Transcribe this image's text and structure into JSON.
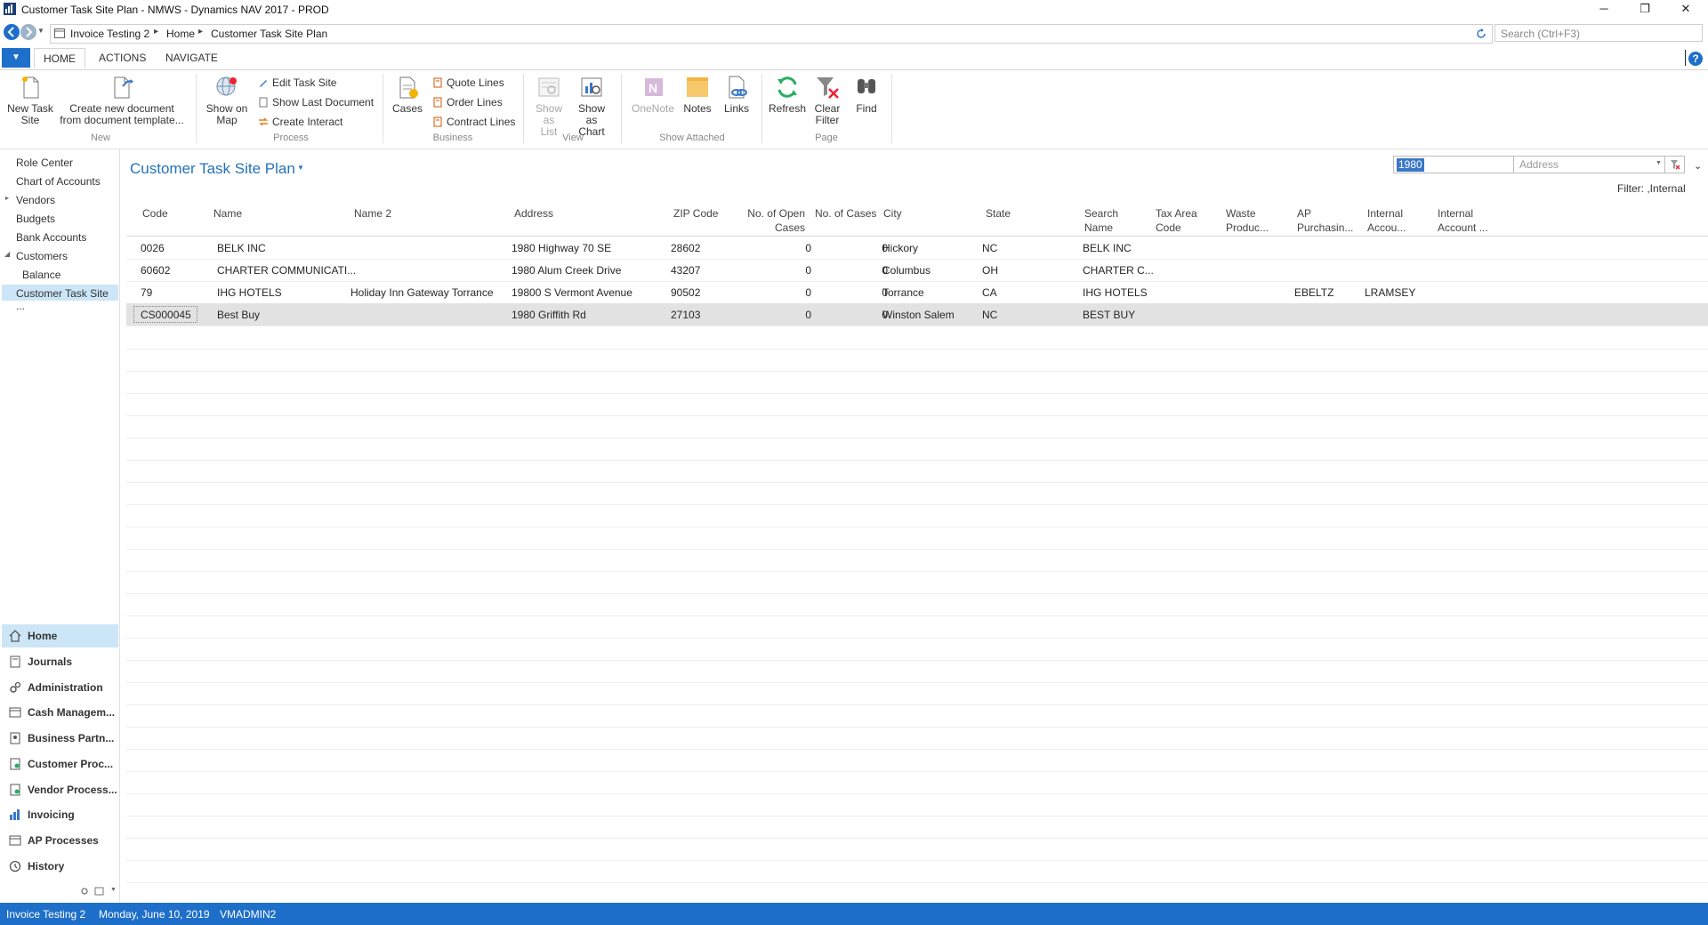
{
  "window": {
    "title": "Customer Task Site Plan - NMWS - Dynamics NAV 2017 - PROD",
    "minimize": "─",
    "restore": "❐",
    "close": "✕"
  },
  "breadcrumb": [
    "Invoice Testing 2",
    "Home",
    "Customer Task Site Plan"
  ],
  "search": {
    "placeholder": "Search (Ctrl+F3)"
  },
  "tabs": [
    {
      "label": "HOME",
      "active": true
    },
    {
      "label": "ACTIONS",
      "active": false
    },
    {
      "label": "NAVIGATE",
      "active": false
    }
  ],
  "ribbon": {
    "new": {
      "label": "New",
      "new_task_site": "New Task Site",
      "create_doc": "Create new document from document template..."
    },
    "process": {
      "label": "Process",
      "show_on_map": "Show on Map",
      "edit_task_site": "Edit Task Site",
      "show_last_document": "Show Last Document",
      "create_interact": "Create Interact"
    },
    "business": {
      "label": "Business",
      "cases": "Cases",
      "quote_lines": "Quote Lines",
      "order_lines": "Order Lines",
      "contract_lines": "Contract Lines"
    },
    "view": {
      "label": "View",
      "show_as_list": "Show as List",
      "show_as_chart": "Show as Chart"
    },
    "show_attached": {
      "label": "Show Attached",
      "onenote": "OneNote",
      "notes": "Notes",
      "links": "Links"
    },
    "page": {
      "label": "Page",
      "refresh": "Refresh",
      "clear_filter": "Clear Filter",
      "find": "Find"
    }
  },
  "leftnav": {
    "items": [
      "Role Center",
      "Chart of Accounts",
      "Vendors",
      "Budgets",
      "Bank Accounts",
      "Customers",
      "Balance",
      "Customer Task Site ..."
    ],
    "selected": "Customer Task Site ...",
    "bottom": [
      "Home",
      "Journals",
      "Administration",
      "Cash Managem...",
      "Business Partn...",
      "Customer Proc...",
      "Vendor Process...",
      "Invoicing",
      "AP Processes",
      "History"
    ]
  },
  "page": {
    "title": "Customer Task Site Plan",
    "filter_value": "1980",
    "filter_field": "Address",
    "filter_label": "Filter:  ,Internal"
  },
  "table": {
    "columns": [
      "Code",
      "Name",
      "Name 2",
      "Address",
      "ZIP Code",
      "No. of Open Cases",
      "No. of Cases",
      "City",
      "State",
      "Search Name",
      "Tax Area Code",
      "Waste Produc...",
      "AP Purchasin...",
      "Internal Accou...",
      "Internal Account ..."
    ],
    "rows": [
      {
        "code": "0026",
        "name": "BELK INC",
        "name2": "",
        "address": "1980 Highway 70 SE",
        "zip": "28602",
        "open_cases": "0",
        "cases": "0",
        "city": "Hickory",
        "state": "NC",
        "search_name": "BELK INC",
        "tax_area": "",
        "waste": "",
        "ap_purch": "",
        "int_accou": "",
        "int_account": ""
      },
      {
        "code": "60602",
        "name": "CHARTER COMMUNICATI...",
        "name2": "",
        "address": "1980 Alum Creek Drive",
        "zip": "43207",
        "open_cases": "0",
        "cases": "0",
        "city": "Columbus",
        "state": "OH",
        "search_name": "CHARTER C...",
        "tax_area": "",
        "waste": "",
        "ap_purch": "",
        "int_accou": "",
        "int_account": ""
      },
      {
        "code": "79",
        "name": "IHG HOTELS",
        "name2": "Holiday Inn Gateway Torrance",
        "address": "19800 S Vermont Avenue",
        "zip": "90502",
        "open_cases": "0",
        "cases": "0",
        "city": "Torrance",
        "state": "CA",
        "search_name": "IHG HOTELS",
        "tax_area": "",
        "waste": "",
        "ap_purch": "EBELTZ",
        "int_accou": "LRAMSEY",
        "int_account": ""
      },
      {
        "code": "CS000045",
        "name": "Best Buy",
        "name2": "",
        "address": "1980 Griffith Rd",
        "zip": "27103",
        "open_cases": "0",
        "cases": "0",
        "city": "Winston Salem",
        "state": "NC",
        "search_name": "BEST BUY",
        "tax_area": "",
        "waste": "",
        "ap_purch": "",
        "int_accou": "",
        "int_account": ""
      }
    ],
    "selected_row": 3
  },
  "statusbar": {
    "company": "Invoice Testing 2",
    "date": "Monday, June 10, 2019",
    "user": "VMADMIN2"
  },
  "colors": {
    "accent": "#1e6fc9",
    "title": "#2673b8",
    "selected_nav": "#cde6f7",
    "selected_row": "#e2e2e2"
  }
}
